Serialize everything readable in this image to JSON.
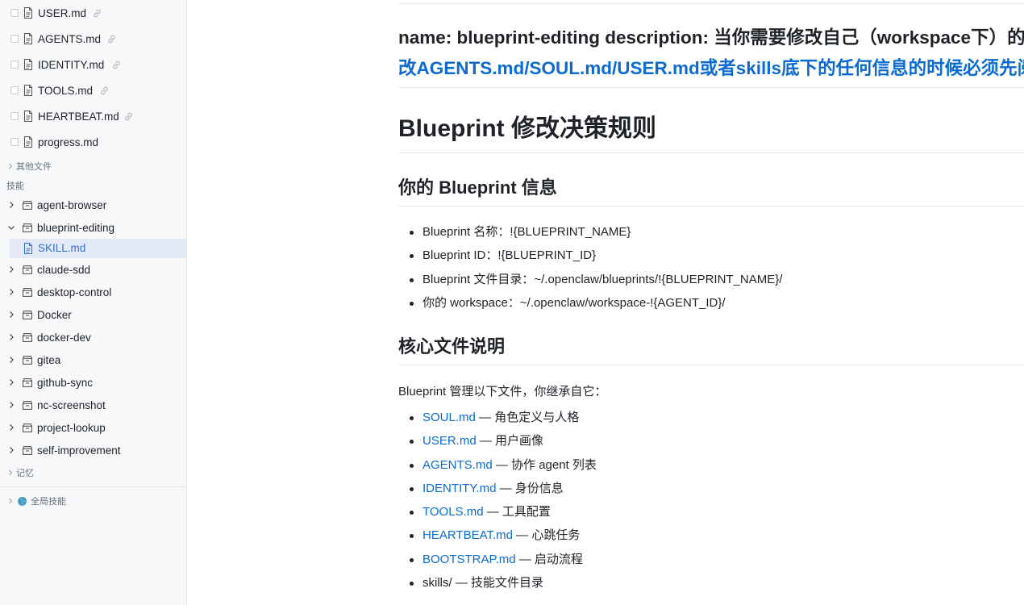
{
  "sidebar": {
    "files": [
      {
        "name": "USER.md",
        "linked": true
      },
      {
        "name": "AGENTS.md",
        "linked": true
      },
      {
        "name": "IDENTITY.md",
        "linked": true
      },
      {
        "name": "TOOLS.md",
        "linked": true
      },
      {
        "name": "HEARTBEAT.md",
        "linked": true
      },
      {
        "name": "progress.md",
        "linked": false
      }
    ],
    "other_files_label": "其他文件",
    "skills_category_label": "技能",
    "skills": [
      {
        "name": "agent-browser",
        "expanded": false
      },
      {
        "name": "blueprint-editing",
        "expanded": true
      },
      {
        "name": "claude-sdd",
        "expanded": false
      },
      {
        "name": "desktop-control",
        "expanded": false
      },
      {
        "name": "Docker",
        "expanded": false
      },
      {
        "name": "docker-dev",
        "expanded": false
      },
      {
        "name": "gitea",
        "expanded": false
      },
      {
        "name": "github-sync",
        "expanded": false
      },
      {
        "name": "nc-screenshot",
        "expanded": false
      },
      {
        "name": "project-lookup",
        "expanded": false
      },
      {
        "name": "self-improvement",
        "expanded": false
      }
    ],
    "active_file": "SKILL.md",
    "memory_label": "记忆",
    "global_skills_label": "全局技能"
  },
  "document": {
    "frontmatter_dark": "name: blueprint-editing description: 当你需要修改自己（workspace下）的文件时调用，",
    "frontmatter_blue": "比如要改AGENTS.md/SOUL.md/USER.md或者skills底下的任何信息的时候必须先阅读该SKILL的内容。",
    "h1": "Blueprint 修改决策规则",
    "section1_title": "你的 Blueprint 信息",
    "section1_items": [
      "Blueprint 名称：!{BLUEPRINT_NAME}",
      "Blueprint ID：!{BLUEPRINT_ID}",
      "Blueprint 文件目录：~/.openclaw/blueprints/!{BLUEPRINT_NAME}/",
      "你的 workspace：~/.openclaw/workspace-!{AGENT_ID}/"
    ],
    "section2_title": "核心文件说明",
    "section2_intro": "Blueprint 管理以下文件，你继承自它：",
    "section2_items": [
      {
        "link": "SOUL.md",
        "desc": " — 角色定义与人格"
      },
      {
        "link": "USER.md",
        "desc": " — 用户画像"
      },
      {
        "link": "AGENTS.md",
        "desc": " — 协作 agent 列表"
      },
      {
        "link": "IDENTITY.md",
        "desc": " — 身份信息"
      },
      {
        "link": "TOOLS.md",
        "desc": " — 工具配置"
      },
      {
        "link": "HEARTBEAT.md",
        "desc": " — 心跳任务"
      },
      {
        "link": "BOOTSTRAP.md",
        "desc": " — 启动流程"
      },
      {
        "link": "",
        "desc": "skills/ — 技能文件目录"
      }
    ]
  },
  "colors": {
    "accent": "#0b6bd0",
    "active_bg": "#e4ebf7",
    "sidebar_bg": "#f7f8fa"
  }
}
